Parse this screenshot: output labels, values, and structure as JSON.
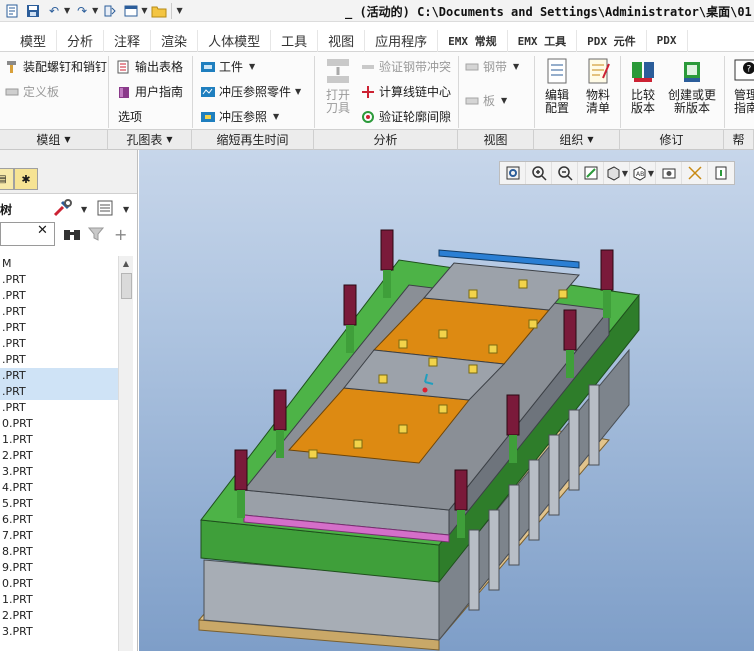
{
  "window": {
    "title": "_ (活动的) C:\\Documents and Settings\\Administrator\\桌面\\01"
  },
  "tabs": [
    "模型",
    "分析",
    "注释",
    "渲染",
    "人体模型",
    "工具",
    "视图",
    "应用程序",
    "EMX 常规",
    "EMX 工具",
    "PDX 元件",
    "PDX"
  ],
  "ribbon": {
    "model_group": {
      "assemble_screws_pins": "装配螺钉和销钉",
      "define_plate": "定义板",
      "footer": "模组"
    },
    "hole_table_group": {
      "export_table": "输出表格",
      "user_guide": "用户指南",
      "options": "选项",
      "footer": "孔图表"
    },
    "regen_group": {
      "workpiece": "工件",
      "stamp_ref_part": "冲压参照零件",
      "stamp_ref": "冲压参照",
      "footer": "缩短再生时间"
    },
    "analysis_group": {
      "open_tool": "打开\n刀具",
      "verify_strip_stamping": "验证钢带冲突",
      "calc_chain_center": "计算线链中心",
      "verify_contour_gap": "验证轮廓间隙",
      "footer": "分析"
    },
    "view_group": {
      "strip": "钢带",
      "plate": "板",
      "footer": "视图"
    },
    "organize_group": {
      "edit_config": "编辑\n配置",
      "bom": "物料\n清单",
      "footer": "组织"
    },
    "revision_group": {
      "compare_versions": "比较\n版本",
      "create_update_version": "创建或更\n新版本",
      "footer": "修订"
    },
    "manage_group": {
      "manage_guide": "管理\n指南",
      "footer": "帮"
    }
  },
  "left_panel": {
    "header_label": "树",
    "search_clear": "✕",
    "tree_items": [
      "M",
      ".PRT",
      ".PRT",
      ".PRT",
      ".PRT",
      ".PRT",
      ".PRT",
      ".PRT",
      ".PRT",
      ".PRT",
      "0.PRT",
      "1.PRT",
      "2.PRT",
      "3.PRT",
      "4.PRT",
      "5.PRT",
      "6.PRT",
      "7.PRT",
      "8.PRT",
      "9.PRT",
      "0.PRT",
      "1.PRT",
      "2.PRT",
      "3.PRT"
    ],
    "selected_rows": [
      7,
      8
    ]
  },
  "viewport_toolbar": {
    "buttons": [
      "zoom-fit-icon",
      "zoom-in-icon",
      "zoom-out-icon",
      "repaint-icon",
      "display-style-icon",
      "saved-views-icon",
      "named-view-icon",
      "datum-display-icon",
      "spin-center-icon"
    ]
  },
  "colors": {
    "viewport_top": "#c7d6ea",
    "viewport_bottom": "#7e9ec8",
    "plate_green": "#3f9f3a",
    "plate_orange": "#dd8a12",
    "plate_gray": "#8a8f96",
    "bolt_maroon": "#7a1a3a",
    "base_wood": "#e2c48c"
  }
}
